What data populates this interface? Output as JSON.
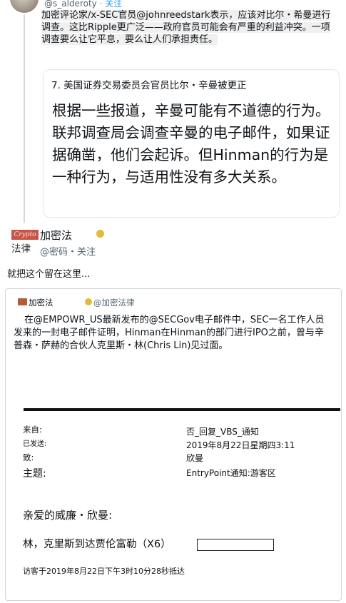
{
  "tweet1": {
    "handle": "@s_alderoty",
    "follow_label": "· 关注",
    "text": "加密评论家/x-SEC官员@johnreedstark表示，应该对比尔・希曼进行调查。这比Ripple更广泛——政府官员可能会有严重的利益冲突。一项调查要么让它平息，要么让人们承担责任。"
  },
  "quote": {
    "title": "7. 美国证券交易委员会官员比尔・辛曼被更正",
    "body": "根据一些报道，辛曼可能有不道德的行为。联邦调查局会调查辛曼的电子邮件，如果证据确凿，他们会起诉。但Hinman的行为是一种行为，与适用性没有多大关系。"
  },
  "tweet2": {
    "logo_text": "Crypto",
    "name": "加密法",
    "law_label": "法律",
    "handle": "@密码・关注",
    "text": "就把这个留在这里..."
  },
  "embed": {
    "author": "加密法",
    "handle": "@加密法律",
    "text": "在@EMPOWR_US最新发布的@SECGov电子邮件中，SEC一名工作人员发来的一封电子邮件证明，Hinman在Hinman的部门进行IPO之前，曾与辛普森・萨赫的合伙人克里斯・林(Chris Lin)见过面。"
  },
  "email": {
    "from_label": "来自:",
    "sent_label": "已发送:",
    "to_label": "致:",
    "subject_label": "主题:",
    "subject_value": "否_回复_VBS_通知",
    "date_value": "2019年8月22日星期四3:11",
    "to_value": "欣曼",
    "entry_value": "EntryPoint通知:游客区",
    "greeting": "亲爱的威廉・欣曼:",
    "arrival": "林，克里斯到达贾伦富勒（X6）",
    "visitor_line": "访客于2019年8月22日下午3时10分28秒抵达"
  }
}
